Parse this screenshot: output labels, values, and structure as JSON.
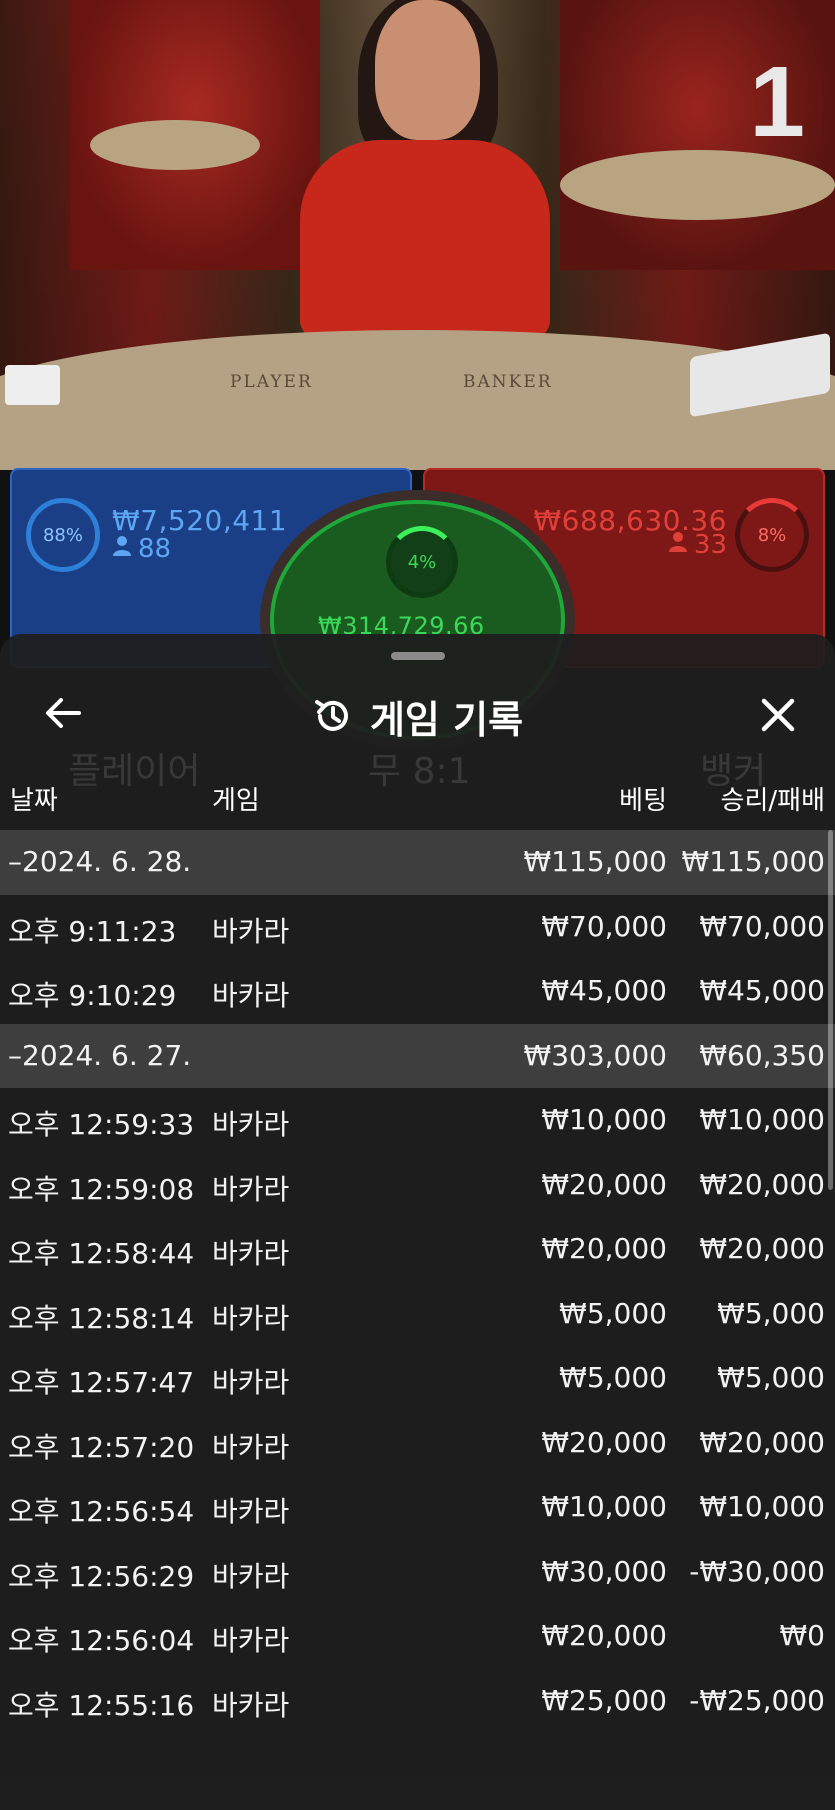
{
  "video": {
    "table_player_label": "PLAYER",
    "table_banker_label": "BANKER",
    "round_number": "1"
  },
  "bet_panels": {
    "player": {
      "percent": "88%",
      "amount": "₩7,520,411",
      "players": "88",
      "fill": 0.88
    },
    "tie": {
      "percent": "4%",
      "amount": "₩314,729.66",
      "fill": 0.04
    },
    "banker": {
      "percent": "8%",
      "amount": "₩688,630.36",
      "players": "33",
      "fill": 0.08
    }
  },
  "sheet": {
    "title": "게임 기록",
    "back_icon": "arrow-left-icon",
    "history_icon": "history-icon",
    "close_icon": "close-icon",
    "ghost_tabs": [
      "플레이어",
      "무 8:1",
      "뱅커"
    ],
    "columns": {
      "date": "날짜",
      "game": "게임",
      "bet": "베팅",
      "result": "승리/패배"
    },
    "rows": [
      {
        "type": "date",
        "date": "–2024. 6. 28.",
        "game": "",
        "bet": "₩115,000",
        "result": "₩115,000"
      },
      {
        "type": "entry",
        "date": "오후 9:11:23",
        "game": "바카라",
        "bet": "₩70,000",
        "result": "₩70,000"
      },
      {
        "type": "entry",
        "date": "오후 9:10:29",
        "game": "바카라",
        "bet": "₩45,000",
        "result": "₩45,000"
      },
      {
        "type": "date",
        "date": "–2024. 6. 27.",
        "game": "",
        "bet": "₩303,000",
        "result": "₩60,350"
      },
      {
        "type": "entry",
        "date": "오후 12:59:33",
        "game": "바카라",
        "bet": "₩10,000",
        "result": "₩10,000"
      },
      {
        "type": "entry",
        "date": "오후 12:59:08",
        "game": "바카라",
        "bet": "₩20,000",
        "result": "₩20,000"
      },
      {
        "type": "entry",
        "date": "오후 12:58:44",
        "game": "바카라",
        "bet": "₩20,000",
        "result": "₩20,000"
      },
      {
        "type": "entry",
        "date": "오후 12:58:14",
        "game": "바카라",
        "bet": "₩5,000",
        "result": "₩5,000"
      },
      {
        "type": "entry",
        "date": "오후 12:57:47",
        "game": "바카라",
        "bet": "₩5,000",
        "result": "₩5,000"
      },
      {
        "type": "entry",
        "date": "오후 12:57:20",
        "game": "바카라",
        "bet": "₩20,000",
        "result": "₩20,000"
      },
      {
        "type": "entry",
        "date": "오후 12:56:54",
        "game": "바카라",
        "bet": "₩10,000",
        "result": "₩10,000"
      },
      {
        "type": "entry",
        "date": "오후 12:56:29",
        "game": "바카라",
        "bet": "₩30,000",
        "result": "-₩30,000"
      },
      {
        "type": "entry",
        "date": "오후 12:56:04",
        "game": "바카라",
        "bet": "₩20,000",
        "result": "₩0"
      },
      {
        "type": "entry",
        "date": "오후 12:55:16",
        "game": "바카라",
        "bet": "₩25,000",
        "result": "-₩25,000"
      }
    ]
  },
  "colors": {
    "player_blue": "#1b3f86",
    "banker_red": "#7d1817",
    "tie_green": "#1a5c1f",
    "sheet_bg": "#1e1e1e",
    "date_row_bg": "#4a4a4a"
  }
}
